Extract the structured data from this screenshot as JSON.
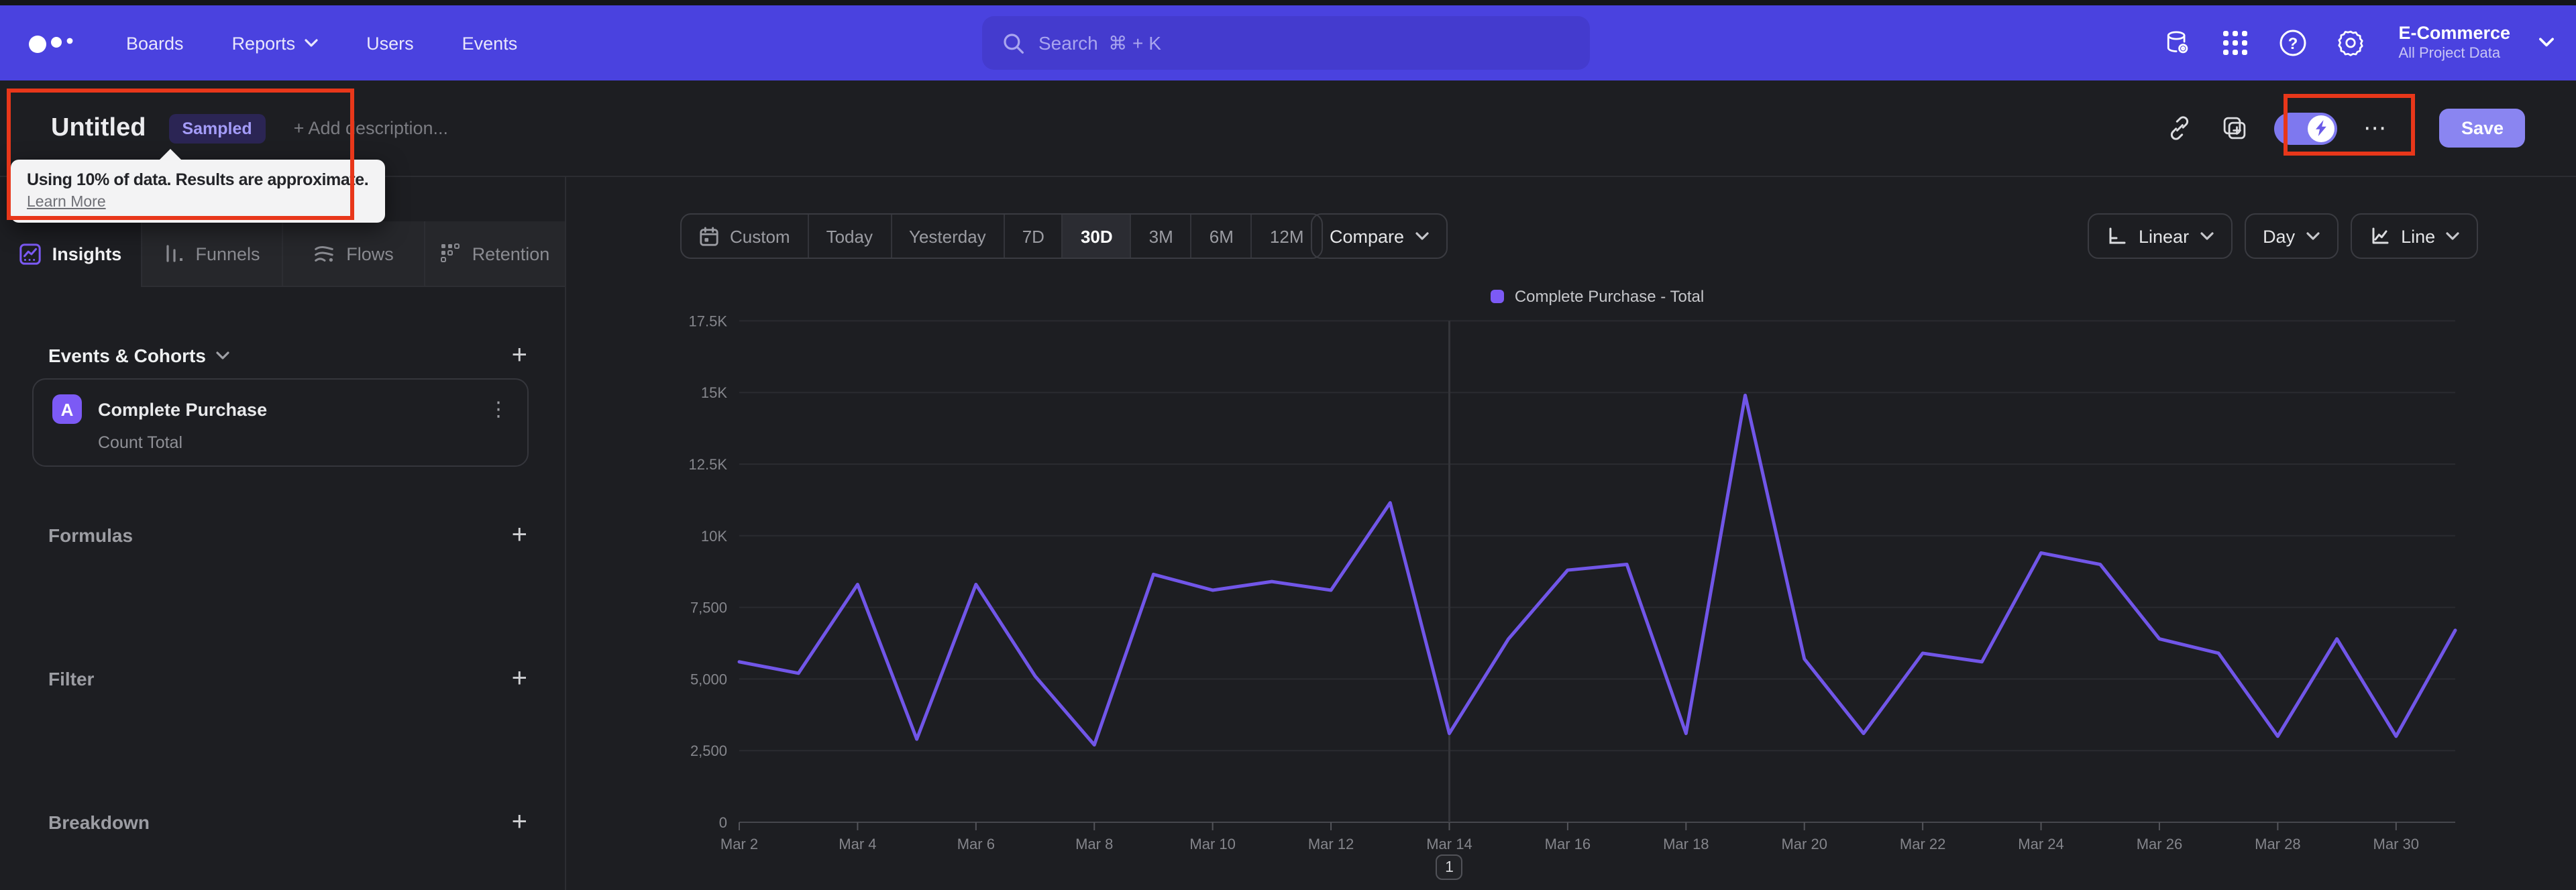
{
  "nav": {
    "items": [
      {
        "label": "Boards"
      },
      {
        "label": "Reports",
        "chevron": true
      },
      {
        "label": "Users"
      },
      {
        "label": "Events"
      }
    ],
    "search": {
      "placeholder": "Search",
      "shortcut": "⌘ + K"
    },
    "icons": [
      "data-management",
      "apps-grid",
      "help",
      "settings"
    ],
    "project": {
      "name": "E-Commerce",
      "scope": "All Project Data"
    }
  },
  "title_bar": {
    "title": "Untitled",
    "badge": "Sampled",
    "description_placeholder": "+ Add description...",
    "sampling_toggle_on": true,
    "more_label": "⋯",
    "save_label": "Save"
  },
  "sampling_tooltip": {
    "message": "Using 10% of data. Results are approximate.",
    "link_label": "Learn More"
  },
  "sidebar": {
    "tabs": [
      {
        "label": "Insights",
        "active": true
      },
      {
        "label": "Funnels",
        "active": false
      },
      {
        "label": "Flows",
        "active": false
      },
      {
        "label": "Retention",
        "active": false
      }
    ],
    "events_section": {
      "title": "Events & Cohorts",
      "add": "+"
    },
    "event_card": {
      "series_letter": "A",
      "event_name": "Complete Purchase",
      "aggregation": "Count Total",
      "kebab": "⋮"
    },
    "sections": [
      {
        "label": "Formulas",
        "add": "+"
      },
      {
        "label": "Filter",
        "add": "+"
      },
      {
        "label": "Breakdown",
        "add": "+"
      }
    ]
  },
  "chart_header": {
    "date_ranges": [
      {
        "label": "Custom"
      },
      {
        "label": "Today"
      },
      {
        "label": "Yesterday"
      },
      {
        "label": "7D"
      },
      {
        "label": "30D",
        "active": true
      },
      {
        "label": "3M"
      },
      {
        "label": "6M"
      },
      {
        "label": "12M"
      }
    ],
    "compare_label": "Compare",
    "y_scale_label": "Linear",
    "interval_label": "Day",
    "chart_type_label": "Line"
  },
  "chart_data": {
    "type": "line",
    "title": "",
    "legend_position": "top-center",
    "grid": "horizontal",
    "x": [
      "Mar 2",
      "Mar 3",
      "Mar 4",
      "Mar 5",
      "Mar 6",
      "Mar 7",
      "Mar 8",
      "Mar 9",
      "Mar 10",
      "Mar 11",
      "Mar 12",
      "Mar 13",
      "Mar 14",
      "Mar 15",
      "Mar 16",
      "Mar 17",
      "Mar 18",
      "Mar 19",
      "Mar 20",
      "Mar 21",
      "Mar 22",
      "Mar 23",
      "Mar 24",
      "Mar 25",
      "Mar 26",
      "Mar 27",
      "Mar 28",
      "Mar 29",
      "Mar 30",
      "Mar 31"
    ],
    "x_tick_every": 2,
    "series": [
      {
        "name": "Complete Purchase - Total",
        "color": "#7156e8",
        "swatch_color": "#7c5af5",
        "values": [
          5600,
          5200,
          8300,
          2900,
          8300,
          5100,
          2700,
          8650,
          8100,
          8400,
          8100,
          11150,
          3100,
          6400,
          8800,
          9000,
          3100,
          14900,
          5700,
          3100,
          5900,
          5600,
          9400,
          9000,
          6400,
          5900,
          3000,
          6400,
          3000,
          6700
        ]
      }
    ],
    "ylim": [
      0,
      17500
    ],
    "yticks": [
      0,
      2500,
      5000,
      7500,
      10000,
      12500,
      15000,
      17500
    ],
    "ytick_labels": [
      "0",
      "2,500",
      "5,000",
      "7,500",
      "10K",
      "12.5K",
      "15K",
      "17.5K"
    ],
    "annotation": {
      "label": "1",
      "date": "Mar 14",
      "day_index": 12
    }
  },
  "colors": {
    "nav_bg": "#4a42df",
    "accent_purple": "#7c5af5",
    "line_color": "#7156e8",
    "annotation_red": "#e8371a",
    "save_button": "#8a85f1",
    "background": "#1d1e22"
  }
}
